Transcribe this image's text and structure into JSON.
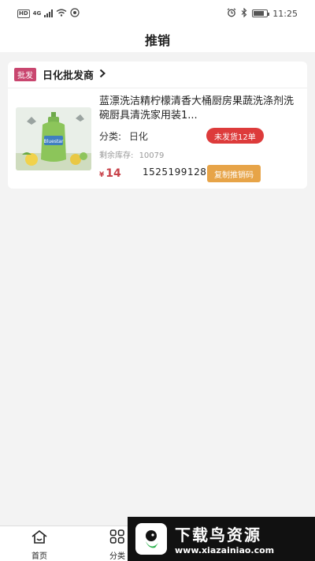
{
  "status_bar": {
    "network_badge": "HD",
    "network_type": "4G",
    "time": "11:25"
  },
  "header": {
    "title": "推销"
  },
  "store": {
    "tag": "批发",
    "name": "日化批发商"
  },
  "product": {
    "title": "蓝漂洗洁精柠檬清香大桶厨房果蔬洗涤剂洗碗厨具清洗家用装1...",
    "category_label": "分类:",
    "category_value": "日化",
    "undelivered_badge": "未发货12单",
    "stock_label": "剩余库存:",
    "stock_value": "10079",
    "currency": "¥",
    "price": "14",
    "promo_code": "1525199128",
    "copy_button": "复制推销码",
    "image_brand_text": "Bluestar"
  },
  "bottom_nav": {
    "items": [
      {
        "label": "首页",
        "icon": "home-icon"
      },
      {
        "label": "分类",
        "icon": "grid-icon"
      }
    ]
  },
  "watermark": {
    "main": "下载鸟资源",
    "url": "www.xiazainiao.com"
  },
  "colors": {
    "tag_bg": "#c9466f",
    "badge_red": "#dd3b3b",
    "price_red": "#c8424a",
    "copy_orange": "#e7a448"
  }
}
